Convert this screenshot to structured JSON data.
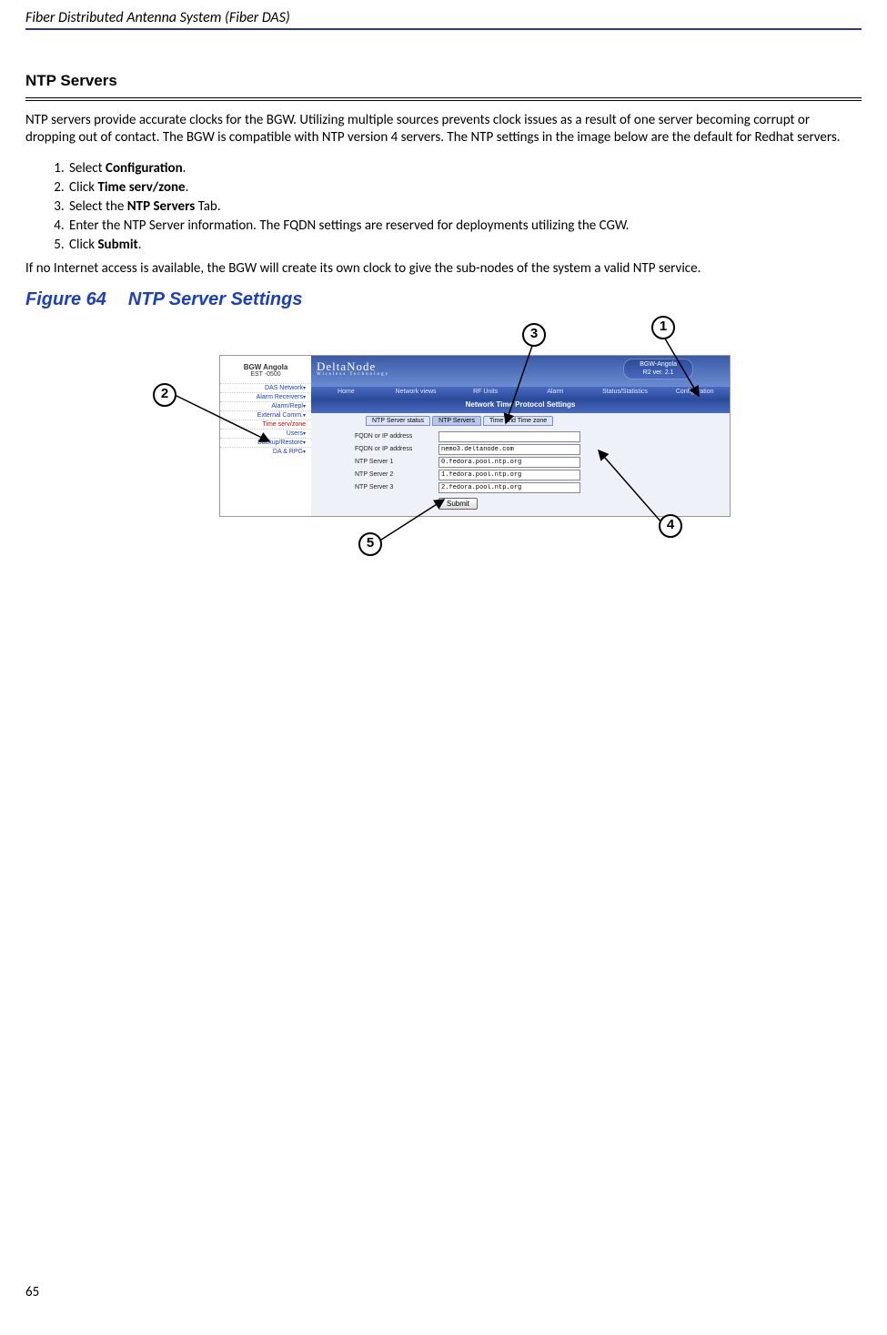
{
  "header": "Fiber Distributed Antenna System (Fiber DAS)",
  "section_title": "NTP Servers",
  "intro": "NTP servers provide accurate clocks for the BGW. Utilizing multiple sources prevents clock issues as a result of one server becoming corrupt or dropping out of contact. The BGW is compatible with NTP version 4 servers. The NTP settings in the image below are the default for Redhat servers.",
  "steps": [
    {
      "pre": "Select ",
      "b": "Configuration",
      "post": "."
    },
    {
      "pre": "Click ",
      "b": "Time serv/zone",
      "post": "."
    },
    {
      "pre": "Select the ",
      "b": "NTP Servers",
      "post": " Tab."
    },
    {
      "pre": "Enter the NTP Server information. The FQDN settings are reserved for deployments utilizing the CGW.",
      "b": "",
      "post": ""
    },
    {
      "pre": "Click ",
      "b": "Submit",
      "post": "."
    }
  ],
  "after_steps": "If no Internet access is available, the BGW will create its own clock to give the sub-nodes of the system a valid NTP service.",
  "figure": {
    "num": "Figure 64",
    "title": "NTP Server Settings"
  },
  "page_num": "65",
  "screenshot": {
    "left_header": "BGW Angola",
    "left_sub": "EST -0500",
    "menu": [
      "DAS Network",
      "Alarm Receivers",
      "Alarm/Repl",
      "External Comm.",
      "Time serv/zone",
      "Users",
      "Backup/Restore",
      "DA & RPG"
    ],
    "menu_selected_index": 4,
    "logo": "DeltaNode",
    "logo_sub": "Wireless  Technology",
    "badge_top": "BGW-Angola",
    "badge_bot": "R2 ver. 2.1",
    "nav": [
      "Home",
      "Network views",
      "RF Units",
      "Alarm",
      "Status/Statistics",
      "Configuration"
    ],
    "section_bar": "Network Time Protocol Settings",
    "tabs": [
      "NTP Server status",
      "NTP Servers",
      "Time and Time zone"
    ],
    "tabs_selected_index": 1,
    "rows": [
      {
        "label": "FQDN or IP address",
        "value": ""
      },
      {
        "label": "FQDN or IP address",
        "value": "nemo3.deltanode.com"
      },
      {
        "label": "NTP Server 1",
        "value": "0.fedora.pool.ntp.org"
      },
      {
        "label": "NTP Server 2",
        "value": "1.fedora.pool.ntp.org"
      },
      {
        "label": "NTP Server 3",
        "value": "2.fedora.pool.ntp.org"
      }
    ],
    "submit": "Submit"
  },
  "callouts": [
    "1",
    "2",
    "3",
    "4",
    "5"
  ]
}
